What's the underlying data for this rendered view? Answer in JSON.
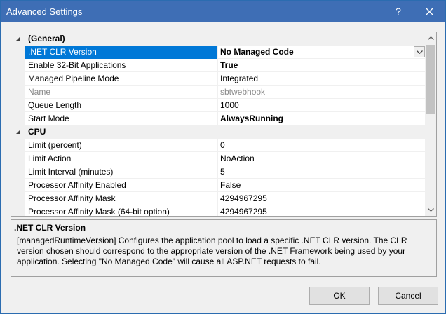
{
  "window": {
    "title": "Advanced Settings",
    "help_label": "?",
    "title_bar_color": "#3e6eb5"
  },
  "grid": {
    "rows": [
      {
        "type": "category",
        "name": "(General)"
      },
      {
        "type": "property",
        "name": ".NET CLR Version",
        "value": "No Managed Code",
        "bold": true,
        "selected": true,
        "has_dropdown": true
      },
      {
        "type": "property",
        "name": "Enable 32-Bit Applications",
        "value": "True",
        "bold": true
      },
      {
        "type": "property",
        "name": "Managed Pipeline Mode",
        "value": "Integrated"
      },
      {
        "type": "property",
        "name": "Name",
        "value": "sbtwebhook",
        "disabled": true
      },
      {
        "type": "property",
        "name": "Queue Length",
        "value": "1000"
      },
      {
        "type": "property",
        "name": "Start Mode",
        "value": "AlwaysRunning",
        "bold": true
      },
      {
        "type": "category",
        "name": "CPU"
      },
      {
        "type": "property",
        "name": "Limit (percent)",
        "value": "0"
      },
      {
        "type": "property",
        "name": "Limit Action",
        "value": "NoAction"
      },
      {
        "type": "property",
        "name": "Limit Interval (minutes)",
        "value": "5"
      },
      {
        "type": "property",
        "name": "Processor Affinity Enabled",
        "value": "False"
      },
      {
        "type": "property",
        "name": "Processor Affinity Mask",
        "value": "4294967295"
      },
      {
        "type": "property",
        "name": "Processor Affinity Mask (64-bit option)",
        "value": "4294967295"
      }
    ],
    "selection_color": "#0078d7"
  },
  "description": {
    "title": ".NET CLR Version",
    "text": "[managedRuntimeVersion] Configures the application pool to load a specific .NET CLR version.  The CLR version chosen should correspond to the appropriate version of the .NET Framework being used by your application. Selecting \"No Managed Code\" will cause all ASP.NET requests to fail."
  },
  "buttons": {
    "ok_label": "OK",
    "cancel_label": "Cancel"
  }
}
